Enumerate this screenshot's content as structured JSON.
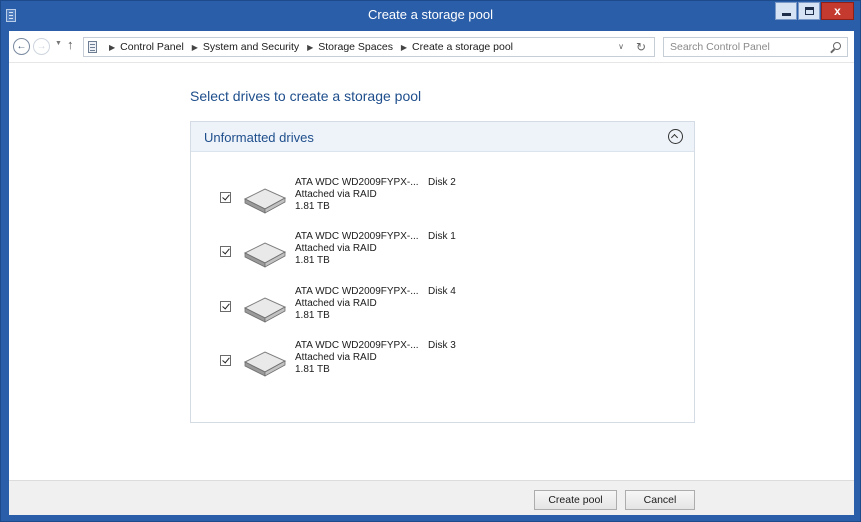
{
  "window": {
    "title": "Create a storage pool",
    "controls": {
      "minimize": "minimize",
      "maximize": "maximize",
      "close": "x"
    }
  },
  "navigation": {
    "back_icon": "back-arrow-icon",
    "forward_icon": "forward-arrow-icon",
    "up_icon": "up-arrow-icon",
    "breadcrumbs": [
      "Control Panel",
      "System and Security",
      "Storage Spaces",
      "Create a storage pool"
    ],
    "search_placeholder": "Search Control Panel"
  },
  "page": {
    "heading": "Select drives to create a storage pool",
    "section_title": "Unformatted drives",
    "drives": [
      {
        "name": "ATA WDC WD2009FYPX-...",
        "disk": "Disk 2",
        "connection": "Attached via RAID",
        "size": "1.81 TB",
        "checked": true
      },
      {
        "name": "ATA WDC WD2009FYPX-...",
        "disk": "Disk 1",
        "connection": "Attached via RAID",
        "size": "1.81 TB",
        "checked": true
      },
      {
        "name": "ATA WDC WD2009FYPX-...",
        "disk": "Disk 4",
        "connection": "Attached via RAID",
        "size": "1.81 TB",
        "checked": true
      },
      {
        "name": "ATA WDC WD2009FYPX-...",
        "disk": "Disk 3",
        "connection": "Attached via RAID",
        "size": "1.81 TB",
        "checked": true
      }
    ]
  },
  "footer": {
    "create_label": "Create pool",
    "cancel_label": "Cancel"
  },
  "colors": {
    "titlebar": "#2a5ea8",
    "link_blue": "#1e4e8c",
    "close_button": "#c43a2f"
  }
}
